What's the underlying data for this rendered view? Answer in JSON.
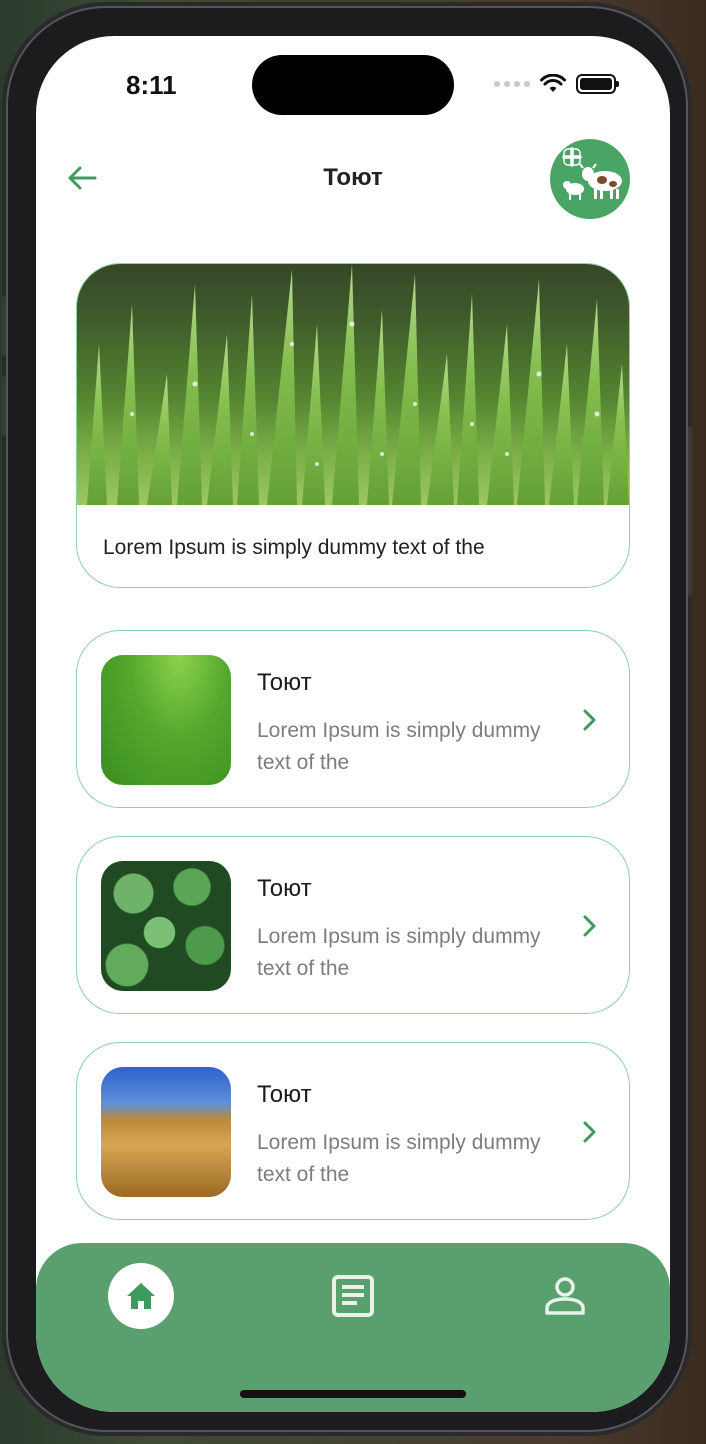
{
  "status_bar": {
    "time": "8:11"
  },
  "header": {
    "title": "Тоют",
    "back_icon": "arrow-left-icon",
    "action_icon": "add-livestock-icon"
  },
  "hero": {
    "caption": "Lorem Ipsum is simply dummy text of the",
    "image": "dewy-grass-photo"
  },
  "list": [
    {
      "title": "Тоют",
      "description": "Lorem Ipsum is simply dummy text of the",
      "image": "green-meadow-photo"
    },
    {
      "title": "Тоют",
      "description": "Lorem Ipsum is simply dummy text of the",
      "image": "green-leaves-photo"
    },
    {
      "title": "Тоют",
      "description": "Lorem Ipsum is simply dummy text of the",
      "image": "wheat-field-photo"
    }
  ],
  "tabbar": {
    "items": [
      "home-icon",
      "document-icon",
      "profile-icon"
    ],
    "active": "home-icon"
  },
  "colors": {
    "accent": "#5aa06e",
    "border": "#8fd0a8",
    "icon_green": "#3f9a5e"
  }
}
